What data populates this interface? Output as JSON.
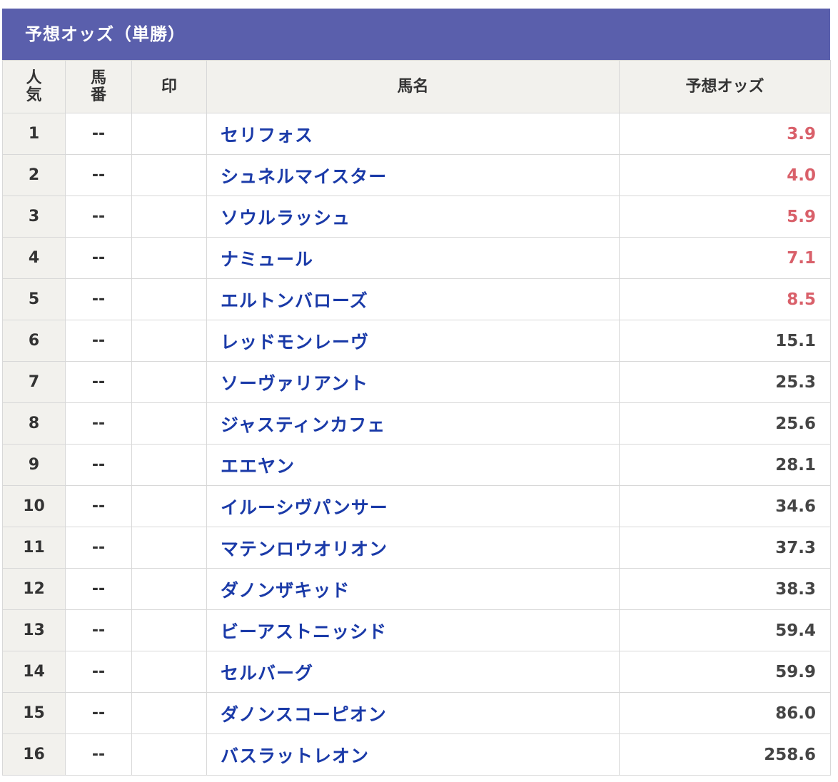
{
  "title": "予想オッズ（単勝）",
  "columns": {
    "popularity": [
      "人",
      "気"
    ],
    "horse_number": [
      "馬",
      "番"
    ],
    "mark": "印",
    "horse_name": "馬名",
    "odds": "予想オッズ"
  },
  "colors": {
    "header_bg": "#5a5fac",
    "name_link": "#1a3aa8",
    "odds_favorite": "#d9606a",
    "odds_normal": "#444444"
  },
  "rows": [
    {
      "rank": "1",
      "number": "--",
      "mark": "",
      "name": "セリフォス",
      "odds": "3.9",
      "hot": true
    },
    {
      "rank": "2",
      "number": "--",
      "mark": "",
      "name": "シュネルマイスター",
      "odds": "4.0",
      "hot": true
    },
    {
      "rank": "3",
      "number": "--",
      "mark": "",
      "name": "ソウルラッシュ",
      "odds": "5.9",
      "hot": true
    },
    {
      "rank": "4",
      "number": "--",
      "mark": "",
      "name": "ナミュール",
      "odds": "7.1",
      "hot": true
    },
    {
      "rank": "5",
      "number": "--",
      "mark": "",
      "name": "エルトンバローズ",
      "odds": "8.5",
      "hot": true
    },
    {
      "rank": "6",
      "number": "--",
      "mark": "",
      "name": "レッドモンレーヴ",
      "odds": "15.1",
      "hot": false
    },
    {
      "rank": "7",
      "number": "--",
      "mark": "",
      "name": "ソーヴァリアント",
      "odds": "25.3",
      "hot": false
    },
    {
      "rank": "8",
      "number": "--",
      "mark": "",
      "name": "ジャスティンカフェ",
      "odds": "25.6",
      "hot": false
    },
    {
      "rank": "9",
      "number": "--",
      "mark": "",
      "name": "エエヤン",
      "odds": "28.1",
      "hot": false
    },
    {
      "rank": "10",
      "number": "--",
      "mark": "",
      "name": "イルーシヴパンサー",
      "odds": "34.6",
      "hot": false
    },
    {
      "rank": "11",
      "number": "--",
      "mark": "",
      "name": "マテンロウオリオン",
      "odds": "37.3",
      "hot": false
    },
    {
      "rank": "12",
      "number": "--",
      "mark": "",
      "name": "ダノンザキッド",
      "odds": "38.3",
      "hot": false
    },
    {
      "rank": "13",
      "number": "--",
      "mark": "",
      "name": "ビーアストニッシド",
      "odds": "59.4",
      "hot": false
    },
    {
      "rank": "14",
      "number": "--",
      "mark": "",
      "name": "セルバーグ",
      "odds": "59.9",
      "hot": false
    },
    {
      "rank": "15",
      "number": "--",
      "mark": "",
      "name": "ダノンスコーピオン",
      "odds": "86.0",
      "hot": false
    },
    {
      "rank": "16",
      "number": "--",
      "mark": "",
      "name": "バスラットレオン",
      "odds": "258.6",
      "hot": false
    }
  ]
}
